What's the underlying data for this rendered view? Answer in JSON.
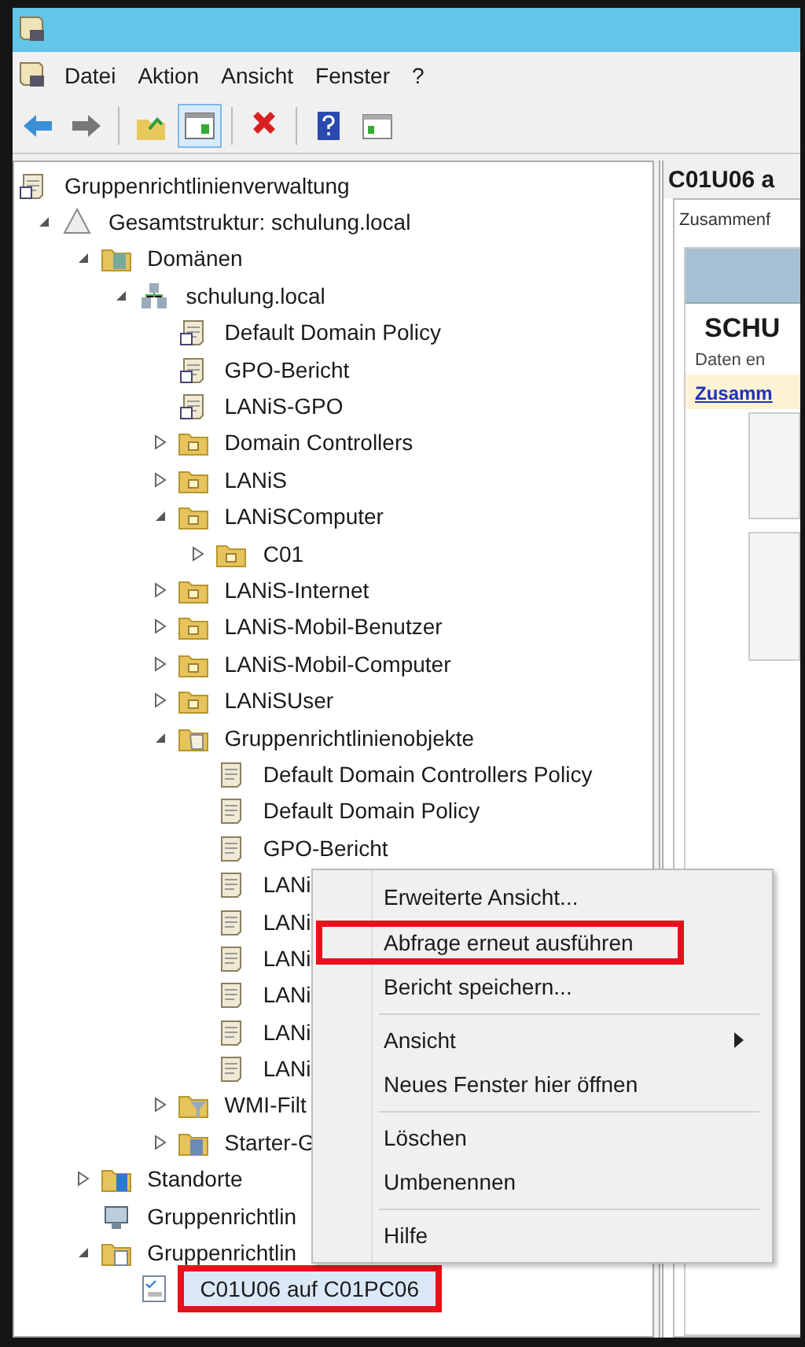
{
  "menu_bar": [
    "Datei",
    "Aktion",
    "Ansicht",
    "Fenster",
    "?"
  ],
  "toolbar": [
    {
      "kind": "back",
      "pressed": false
    },
    {
      "kind": "forward",
      "pressed": false
    },
    {
      "kind": "sep"
    },
    {
      "kind": "up",
      "pressed": false
    },
    {
      "kind": "tree",
      "pressed": true
    },
    {
      "kind": "sep"
    },
    {
      "kind": "delete",
      "pressed": false
    },
    {
      "kind": "sep"
    },
    {
      "kind": "help",
      "pressed": false
    },
    {
      "kind": "pane",
      "pressed": false
    }
  ],
  "tree": [
    {
      "label": "Gruppenrichtlinienverwaltung",
      "kind": "console",
      "selected": false,
      "outlined": false,
      "children": [
        {
          "label": "Gesamtstruktur: schulung.local",
          "kind": "forest",
          "selected": false,
          "outlined": false,
          "expanded": true,
          "children": [
            {
              "label": "Domänen",
              "kind": "domains",
              "selected": false,
              "outlined": false,
              "expanded": true,
              "children": [
                {
                  "label": "schulung.local",
                  "kind": "domain",
                  "selected": false,
                  "outlined": false,
                  "expanded": true,
                  "children": [
                    {
                      "label": "Default Domain Policy",
                      "kind": "gpo-link",
                      "selected": false,
                      "outlined": false
                    },
                    {
                      "label": "GPO-Bericht",
                      "kind": "gpo-link",
                      "selected": false,
                      "outlined": false
                    },
                    {
                      "label": "LANiS-GPO",
                      "kind": "gpo-link",
                      "selected": false,
                      "outlined": false
                    },
                    {
                      "label": "Domain Controllers",
                      "kind": "ou",
                      "selected": false,
                      "outlined": false,
                      "expanded": false
                    },
                    {
                      "label": "LANiS",
                      "kind": "ou",
                      "selected": false,
                      "outlined": false,
                      "expanded": false
                    },
                    {
                      "label": "LANiSComputer",
                      "kind": "ou",
                      "selected": false,
                      "outlined": false,
                      "expanded": true,
                      "children": [
                        {
                          "label": "C01",
                          "kind": "ou",
                          "selected": false,
                          "outlined": false,
                          "expanded": false
                        }
                      ]
                    },
                    {
                      "label": "LANiS-Internet",
                      "kind": "ou",
                      "selected": false,
                      "outlined": false,
                      "expanded": false
                    },
                    {
                      "label": "LANiS-Mobil-Benutzer",
                      "kind": "ou",
                      "selected": false,
                      "outlined": false,
                      "expanded": false
                    },
                    {
                      "label": "LANiS-Mobil-Computer",
                      "kind": "ou",
                      "selected": false,
                      "outlined": false,
                      "expanded": false
                    },
                    {
                      "label": "LANiSUser",
                      "kind": "ou",
                      "selected": false,
                      "outlined": false,
                      "expanded": false
                    },
                    {
                      "label": "Gruppenrichtlinienobjekte",
                      "kind": "gpo-folder",
                      "selected": false,
                      "outlined": false,
                      "expanded": true,
                      "children": [
                        {
                          "label": "Default Domain Controllers Policy",
                          "kind": "gpo",
                          "selected": false,
                          "outlined": false
                        },
                        {
                          "label": "Default Domain Policy",
                          "kind": "gpo",
                          "selected": false,
                          "outlined": false
                        },
                        {
                          "label": "GPO-Bericht",
                          "kind": "gpo",
                          "selected": false,
                          "outlined": false
                        },
                        {
                          "label": "LANi",
                          "kind": "gpo",
                          "selected": false,
                          "outlined": false
                        },
                        {
                          "label": "LANi",
                          "kind": "gpo",
                          "selected": false,
                          "outlined": false
                        },
                        {
                          "label": "LANi",
                          "kind": "gpo",
                          "selected": false,
                          "outlined": false
                        },
                        {
                          "label": "LANi",
                          "kind": "gpo",
                          "selected": false,
                          "outlined": false
                        },
                        {
                          "label": "LANi",
                          "kind": "gpo",
                          "selected": false,
                          "outlined": false
                        },
                        {
                          "label": "LANi",
                          "kind": "gpo",
                          "selected": false,
                          "outlined": false
                        }
                      ]
                    },
                    {
                      "label": "WMI-Filt",
                      "kind": "wmi",
                      "selected": false,
                      "outlined": false,
                      "expanded": false
                    },
                    {
                      "label": "Starter-G",
                      "kind": "starter",
                      "selected": false,
                      "outlined": false,
                      "expanded": false
                    }
                  ]
                }
              ]
            },
            {
              "label": "Standorte",
              "kind": "sites",
              "selected": false,
              "outlined": false,
              "expanded": false
            },
            {
              "label": "Gruppenrichtlin",
              "kind": "modeling",
              "selected": false,
              "outlined": false
            },
            {
              "label": "Gruppenrichtlin",
              "kind": "results",
              "selected": false,
              "outlined": false,
              "expanded": true,
              "children": [
                {
                  "label": "C01U06 auf C01PC06",
                  "kind": "report",
                  "selected": true,
                  "outlined": true
                }
              ]
            }
          ]
        }
      ]
    }
  ],
  "context_menu": [
    {
      "kind": "item",
      "label": "Erweiterte Ansicht...",
      "outlined": false,
      "submenu": false
    },
    {
      "kind": "item",
      "label": "Abfrage erneut ausführen",
      "outlined": true,
      "submenu": false
    },
    {
      "kind": "item",
      "label": "Bericht speichern...",
      "outlined": false,
      "submenu": false
    },
    {
      "kind": "separator"
    },
    {
      "kind": "item",
      "label": "Ansicht",
      "outlined": false,
      "submenu": true
    },
    {
      "kind": "item",
      "label": "Neues Fenster hier öffnen",
      "outlined": false,
      "submenu": false
    },
    {
      "kind": "separator"
    },
    {
      "kind": "item",
      "label": "Löschen",
      "outlined": false,
      "submenu": false
    },
    {
      "kind": "item",
      "label": "Umbenennen",
      "outlined": false,
      "submenu": false
    },
    {
      "kind": "separator"
    },
    {
      "kind": "item",
      "label": "Hilfe",
      "outlined": false,
      "submenu": false
    }
  ],
  "details": {
    "title": "C01U06 a",
    "tab": "Zusammenf",
    "heading": "SCHU",
    "subtext": "Daten en",
    "link": "Zusamm"
  }
}
